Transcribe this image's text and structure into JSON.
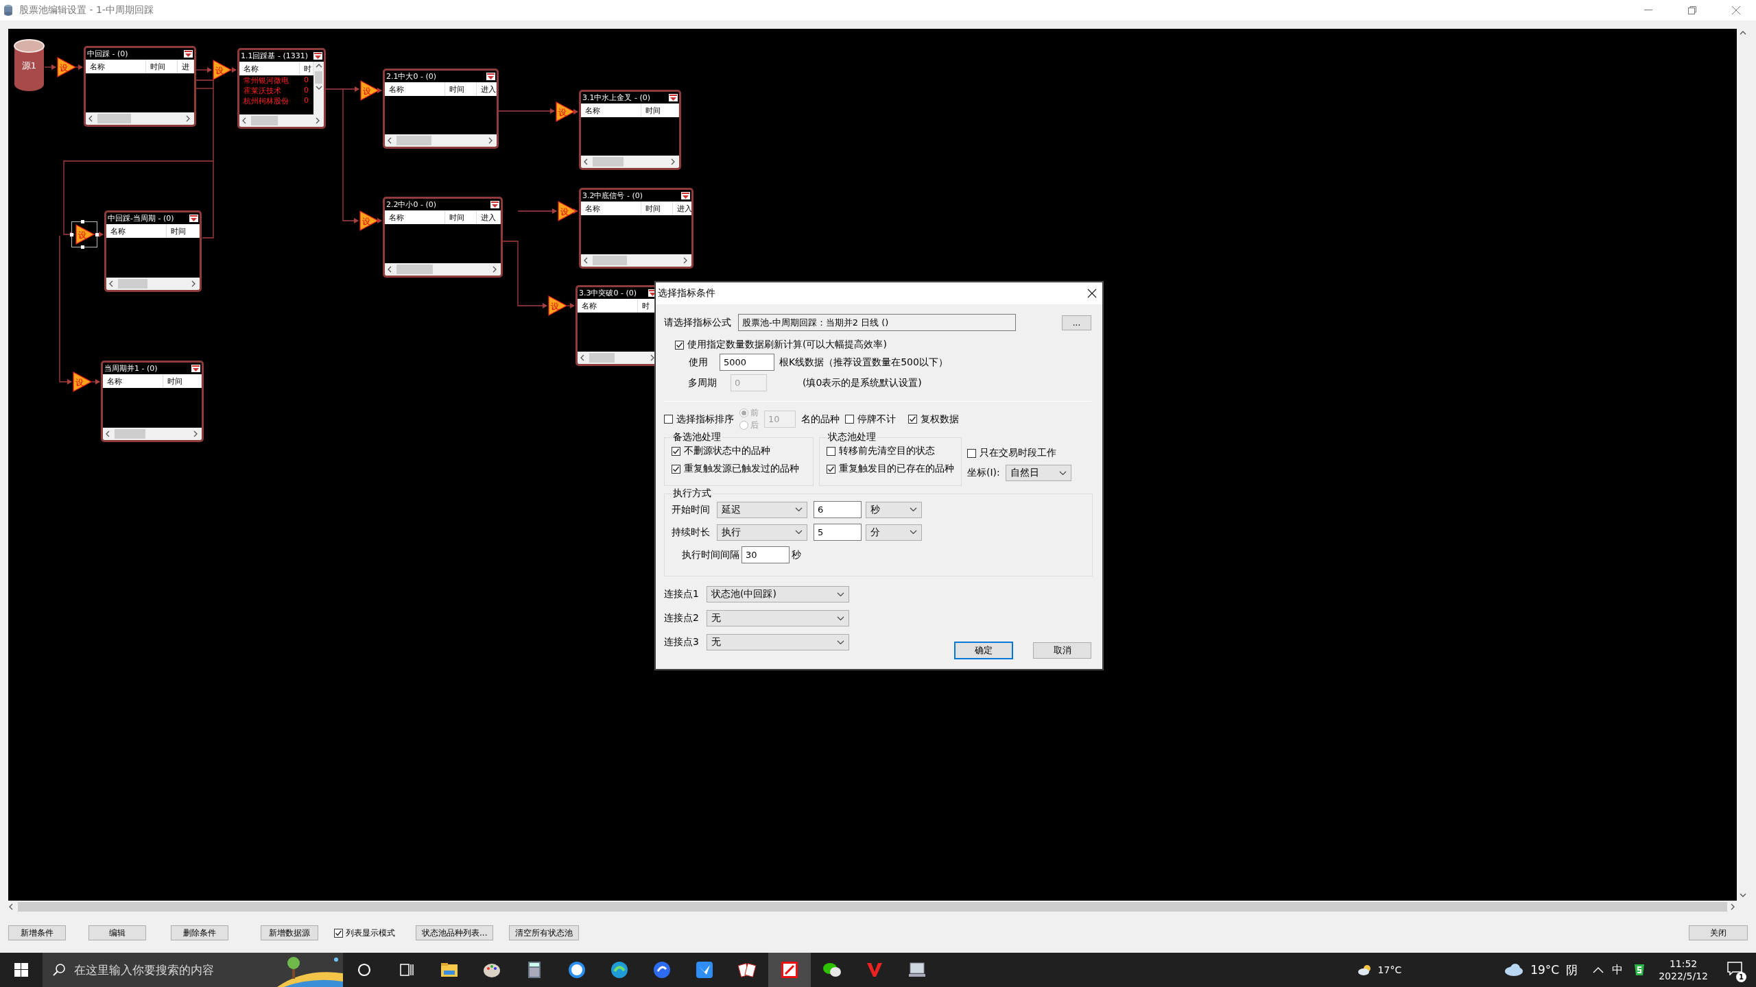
{
  "window": {
    "title": "股票池编辑设置 - 1-中周期回踩"
  },
  "canvas": {
    "source": {
      "label": "源1"
    },
    "condition_nodes": [
      {
        "label": "设",
        "selected": false
      },
      {
        "label": "设",
        "selected": false
      },
      {
        "label": "设",
        "selected": false
      },
      {
        "label": "设",
        "selected": false
      },
      {
        "label": "设",
        "selected": true
      },
      {
        "label": "设",
        "selected": false
      },
      {
        "label": "设",
        "selected": false
      },
      {
        "label": "设",
        "selected": false
      },
      {
        "label": "设",
        "selected": false
      }
    ],
    "pools": [
      {
        "title": "中回踩 - (0)",
        "columns": [
          "名称",
          "时间",
          "进"
        ]
      },
      {
        "title": "1.1回踩基 - (1331)",
        "columns": [
          "名称",
          "时"
        ],
        "rows": [
          {
            "name": "常州银河微电",
            "value": "0"
          },
          {
            "name": "霍莱沃技术",
            "value": "0"
          },
          {
            "name": "杭州柯林股份",
            "value": "0"
          }
        ]
      },
      {
        "title": "2.1中大0 - (0)",
        "columns": [
          "名称",
          "时间",
          "进入"
        ]
      },
      {
        "title": "3.1中水上金叉 - (0)",
        "columns": [
          "名称",
          "时间"
        ]
      },
      {
        "title": "中回踩-当周期 - (0)",
        "columns": [
          "名称",
          "时间"
        ]
      },
      {
        "title": "2.2中小0 - (0)",
        "columns": [
          "名称",
          "时间",
          "进入"
        ]
      },
      {
        "title": "3.2中底信号 - (0)",
        "columns": [
          "名称",
          "时间",
          "进入"
        ]
      },
      {
        "title": "3.3中突破0 - (0)",
        "columns": [
          "名称",
          "时"
        ]
      },
      {
        "title": "当周期并1 - (0)",
        "columns": [
          "名称",
          "时间"
        ]
      }
    ]
  },
  "dialog": {
    "title": "选择指标条件",
    "formula": {
      "label": "请选择指标公式",
      "value": "股票池-中周期回踩：当期并2 日线 ()",
      "browse": "..."
    },
    "refresh": {
      "label": "使用指定数量数据刷新计算(可以大幅提高效率)",
      "checked": true
    },
    "bars": {
      "label": "使用",
      "value": "5000",
      "note": "根K线数据（推荐设置数量在500以下）"
    },
    "multi_period": {
      "label": "多周期",
      "value": "0",
      "disabled": true,
      "note": "(填0表示的是系统默认设置)"
    },
    "sort": {
      "label": "选择指标排序",
      "checked": false,
      "disabled": true,
      "options": [
        {
          "label": "前",
          "selected": true
        },
        {
          "label": "后",
          "selected": false
        }
      ],
      "count": "10",
      "suffix": "名的品种"
    },
    "suspend": {
      "label": "停牌不计",
      "checked": false
    },
    "adjusted": {
      "label": "复权数据",
      "checked": true
    },
    "candidate_group": {
      "title": "备选池处理",
      "options": [
        {
          "label": "不删源状态中的品种",
          "checked": true
        },
        {
          "label": "重复触发源已触发过的品种",
          "checked": true
        }
      ]
    },
    "state_group": {
      "title": "状态池处理",
      "options": [
        {
          "label": "转移前先清空目的状态",
          "checked": false
        },
        {
          "label": "重复触发目的已存在的品种",
          "checked": true
        }
      ]
    },
    "trading_only": {
      "label": "只在交易时段工作",
      "checked": false
    },
    "axis": {
      "label": "坐标(I):",
      "value": "自然日"
    },
    "execution": {
      "title": "执行方式",
      "rows": [
        {
          "label": "开始时间",
          "mode": "延迟",
          "value": "6",
          "unit": "秒"
        },
        {
          "label": "持续时长",
          "mode": "执行",
          "value": "5",
          "unit": "分"
        }
      ],
      "interval": {
        "label": "执行时间间隔",
        "value": "30",
        "unit": "秒"
      }
    },
    "connections": [
      {
        "label": "连接点1",
        "value": "状态池(中回踩)"
      },
      {
        "label": "连接点2",
        "value": "无"
      },
      {
        "label": "连接点3",
        "value": "无"
      }
    ],
    "ok": "确定",
    "cancel": "取消"
  },
  "toolbar": {
    "items": [
      {
        "kind": "button",
        "label": "新增条件"
      },
      {
        "kind": "button",
        "label": "编辑"
      },
      {
        "kind": "button",
        "label": "删除条件"
      },
      {
        "kind": "button",
        "label": "新增数据源"
      },
      {
        "kind": "checkbox",
        "label": "列表显示模式",
        "checked": true
      },
      {
        "kind": "button",
        "label": "状态池品种列表..."
      },
      {
        "kind": "button",
        "label": "清空所有状态池"
      }
    ],
    "close": "关闭"
  },
  "taskbar": {
    "search_placeholder": "在这里输入你要搜索的内容",
    "weather_small": "17°C",
    "weather_temp": "19°C",
    "weather_desc": "阴",
    "ime": "中",
    "time": "11:52",
    "date": "2022/5/12",
    "notifications": "1"
  }
}
